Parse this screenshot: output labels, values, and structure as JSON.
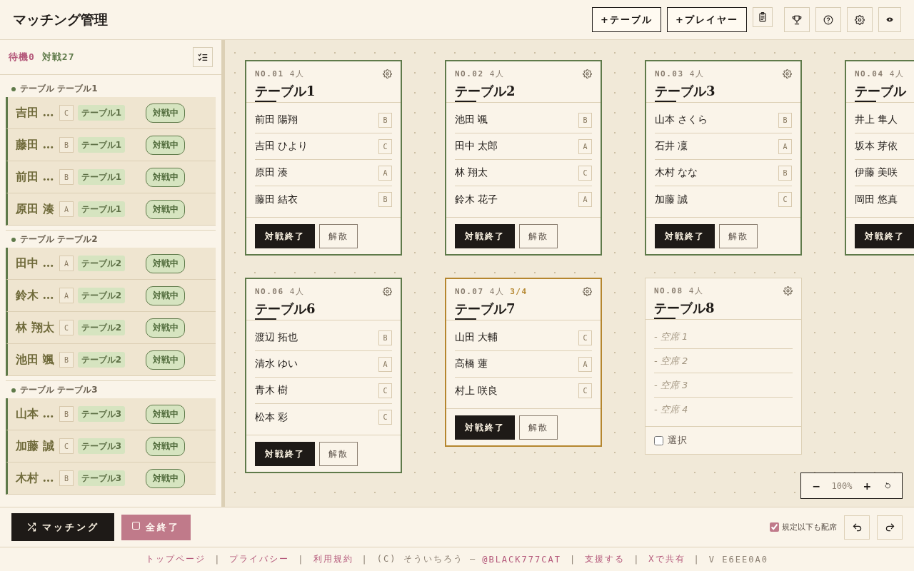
{
  "header": {
    "title": "マッチング管理",
    "buttons": [
      {
        "label": "+テーブル"
      },
      {
        "label": "+プレイヤー"
      }
    ]
  },
  "sidebar": {
    "counts": [
      {
        "kind": "waiting",
        "text": "待機0"
      },
      {
        "kind": "playing",
        "text": "対戦27"
      }
    ],
    "groups": [
      {
        "label": "テーブル テーブル1",
        "players": [
          {
            "name": "吉田 …",
            "rank": "C",
            "table": "テーブル1",
            "status": "対戦中"
          },
          {
            "name": "藤田 …",
            "rank": "B",
            "table": "テーブル1",
            "status": "対戦中"
          },
          {
            "name": "前田 …",
            "rank": "B",
            "table": "テーブル1",
            "status": "対戦中"
          },
          {
            "name": "原田 湊",
            "rank": "A",
            "table": "テーブル1",
            "status": "対戦中"
          }
        ]
      },
      {
        "label": "テーブル テーブル2",
        "players": [
          {
            "name": "田中 …",
            "rank": "A",
            "table": "テーブル2",
            "status": "対戦中"
          },
          {
            "name": "鈴木 …",
            "rank": "A",
            "table": "テーブル2",
            "status": "対戦中"
          },
          {
            "name": "林 翔太",
            "rank": "C",
            "table": "テーブル2",
            "status": "対戦中"
          },
          {
            "name": "池田 颯",
            "rank": "B",
            "table": "テーブル2",
            "status": "対戦中"
          }
        ]
      },
      {
        "label": "テーブル テーブル3",
        "players": [
          {
            "name": "山本 …",
            "rank": "B",
            "table": "テーブル3",
            "status": "対戦中"
          },
          {
            "name": "加藤 誠",
            "rank": "C",
            "table": "テーブル3",
            "status": "対戦中"
          },
          {
            "name": "木村 …",
            "rank": "B",
            "table": "テーブル3",
            "status": "対戦中"
          }
        ]
      }
    ]
  },
  "canvas": {
    "rows": [
      {
        "tables": [
          {
            "kind": "playing",
            "number": "NO.01",
            "capacity": "4人",
            "name": "テーブル1",
            "seats": [
              {
                "kind": "player",
                "name": "前田 陽翔",
                "rank": "B"
              },
              {
                "kind": "player",
                "name": "吉田 ひより",
                "rank": "C"
              },
              {
                "kind": "player",
                "name": "原田 湊",
                "rank": "A"
              },
              {
                "kind": "player",
                "name": "藤田 結衣",
                "rank": "B"
              }
            ],
            "actions": [
              {
                "kind": "end",
                "label": "対戦終了"
              },
              {
                "kind": "disband",
                "label": "解散"
              }
            ]
          },
          {
            "kind": "playing",
            "number": "NO.02",
            "capacity": "4人",
            "name": "テーブル2",
            "seats": [
              {
                "kind": "player",
                "name": "池田 颯",
                "rank": "B"
              },
              {
                "kind": "player",
                "name": "田中 太郎",
                "rank": "A"
              },
              {
                "kind": "player",
                "name": "林 翔太",
                "rank": "C"
              },
              {
                "kind": "player",
                "name": "鈴木 花子",
                "rank": "A"
              }
            ],
            "actions": [
              {
                "kind": "end",
                "label": "対戦終了"
              },
              {
                "kind": "disband",
                "label": "解散"
              }
            ]
          },
          {
            "kind": "playing",
            "number": "NO.03",
            "capacity": "4人",
            "name": "テーブル3",
            "seats": [
              {
                "kind": "player",
                "name": "山本 さくら",
                "rank": "B"
              },
              {
                "kind": "player",
                "name": "石井 凜",
                "rank": "A"
              },
              {
                "kind": "player",
                "name": "木村 なな",
                "rank": "B"
              },
              {
                "kind": "player",
                "name": "加藤 誠",
                "rank": "C"
              }
            ],
            "actions": [
              {
                "kind": "end",
                "label": "対戦終了"
              },
              {
                "kind": "disband",
                "label": "解散"
              }
            ]
          },
          {
            "kind": "playing",
            "number": "NO.04",
            "capacity": "4人",
            "name": "テーブル",
            "seats": [
              {
                "kind": "player",
                "name": "井上 隼人"
              },
              {
                "kind": "player",
                "name": "坂本 芽依"
              },
              {
                "kind": "player",
                "name": "伊藤 美咲"
              },
              {
                "kind": "player",
                "name": "岡田 悠真"
              }
            ],
            "actions": [
              {
                "kind": "end",
                "label": "対戦終了"
              }
            ]
          }
        ]
      },
      {
        "tables": [
          {
            "kind": "playing",
            "number": "NO.06",
            "capacity": "4人",
            "name": "テーブル6",
            "seats": [
              {
                "kind": "player",
                "name": "渡辺 拓也",
                "rank": "B"
              },
              {
                "kind": "player",
                "name": "清水 ゆい",
                "rank": "A"
              },
              {
                "kind": "player",
                "name": "青木 樹",
                "rank": "C"
              },
              {
                "kind": "player",
                "name": "松本 彩",
                "rank": "C"
              }
            ],
            "actions": [
              {
                "kind": "end",
                "label": "対戦終了"
              },
              {
                "kind": "disband",
                "label": "解散"
              }
            ]
          },
          {
            "kind": "short",
            "number": "NO.07",
            "capacity": "4人",
            "count": "3/4",
            "name": "テーブル7",
            "seats": [
              {
                "kind": "player",
                "name": "山田 大輔",
                "rank": "C"
              },
              {
                "kind": "player",
                "name": "高橋 蓮",
                "rank": "A"
              },
              {
                "kind": "player",
                "name": "村上 咲良",
                "rank": "C"
              }
            ],
            "actions": [
              {
                "kind": "end",
                "label": "対戦終了"
              },
              {
                "kind": "disband",
                "label": "解散"
              }
            ]
          },
          {
            "kind": "open",
            "number": "NO.08",
            "capacity": "4人",
            "name": "テーブル8",
            "seats": [
              {
                "kind": "vacant",
                "label": "- 空席 1"
              },
              {
                "kind": "vacant",
                "label": "- 空席 2"
              },
              {
                "kind": "vacant",
                "label": "- 空席 3"
              },
              {
                "kind": "vacant",
                "label": "- 空席 4"
              }
            ],
            "select": {
              "label": "選択",
              "checked": false
            }
          }
        ]
      }
    ],
    "zoom": {
      "minus": "−",
      "value": "100%",
      "plus": "+"
    }
  },
  "toolbar": {
    "buttons": [
      {
        "kind": "match",
        "label": "マッチング"
      },
      {
        "kind": "finish",
        "label": "全終了"
      }
    ],
    "option": {
      "label": "規定以下も配席",
      "checked": true
    }
  },
  "footer": {
    "items": [
      {
        "kind": "link",
        "text": "トップページ"
      },
      {
        "kind": "separator",
        "text": "|"
      },
      {
        "kind": "link",
        "text": "プライバシー"
      },
      {
        "kind": "separator",
        "text": "|"
      },
      {
        "kind": "link",
        "text": "利用規約"
      },
      {
        "kind": "separator",
        "text": "|"
      },
      {
        "kind": "note",
        "text": "(C) そういちろう —"
      },
      {
        "kind": "link",
        "text": "@BLACK777CAT"
      },
      {
        "kind": "separator",
        "text": "|"
      },
      {
        "kind": "link",
        "text": "支援する"
      },
      {
        "kind": "separator",
        "text": "|"
      },
      {
        "kind": "link",
        "text": "Xで共有"
      },
      {
        "kind": "separator",
        "text": "|"
      },
      {
        "kind": "note",
        "text": "V E6EE0A0"
      }
    ]
  }
}
